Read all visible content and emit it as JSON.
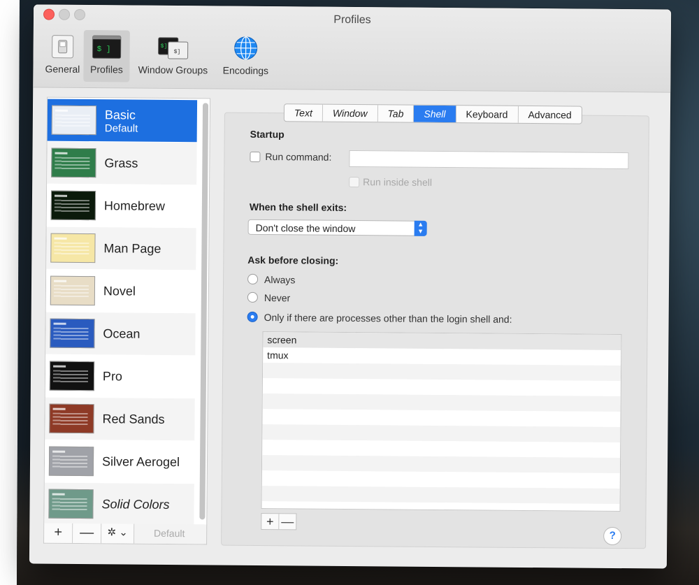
{
  "window": {
    "title": "Profiles"
  },
  "toolbar": [
    {
      "label": "General",
      "icon": "general-switch-icon"
    },
    {
      "label": "Profiles",
      "icon": "terminal-profile-icon"
    },
    {
      "label": "Window Groups",
      "icon": "window-groups-icon"
    },
    {
      "label": "Encodings",
      "icon": "globe-icon"
    }
  ],
  "profiles": [
    {
      "name": "Basic",
      "subtitle": "Default",
      "color": "#e9eef5"
    },
    {
      "name": "Grass",
      "color": "#2f7d4a"
    },
    {
      "name": "Homebrew",
      "color": "#0b1a0b"
    },
    {
      "name": "Man Page",
      "color": "#f6e7a6"
    },
    {
      "name": "Novel",
      "color": "#e8ddc6"
    },
    {
      "name": "Ocean",
      "color": "#2a5bbf"
    },
    {
      "name": "Pro",
      "color": "#111111"
    },
    {
      "name": "Red Sands",
      "color": "#8e3a26"
    },
    {
      "name": "Silver Aerogel",
      "color": "#a0a2a8"
    },
    {
      "name": "Solid Colors",
      "color": "#6f9a8a"
    }
  ],
  "list_buttons": {
    "add": "+",
    "remove": "—",
    "gear": "✲ ⌄",
    "default": "Default"
  },
  "tabs": [
    {
      "label": "Text"
    },
    {
      "label": "Window"
    },
    {
      "label": "Tab"
    },
    {
      "label": "Shell",
      "active": true
    },
    {
      "label": "Keyboard"
    },
    {
      "label": "Advanced"
    }
  ],
  "shell": {
    "startup_title": "Startup",
    "run_command_label": "Run command:",
    "run_command_value": "",
    "run_inside_shell_label": "Run inside shell",
    "exits_title": "When the shell exits:",
    "exits_value": "Don't close the window",
    "ask_title": "Ask before closing:",
    "option_always": "Always",
    "option_never": "Never",
    "option_only_if": "Only if there are processes other than the login shell and:",
    "processes": [
      "screen",
      "tmux"
    ],
    "add": "+",
    "remove": "—",
    "help": "?"
  },
  "colors": {
    "accent": "#2a7cf0",
    "selection": "#1d6fe0"
  }
}
